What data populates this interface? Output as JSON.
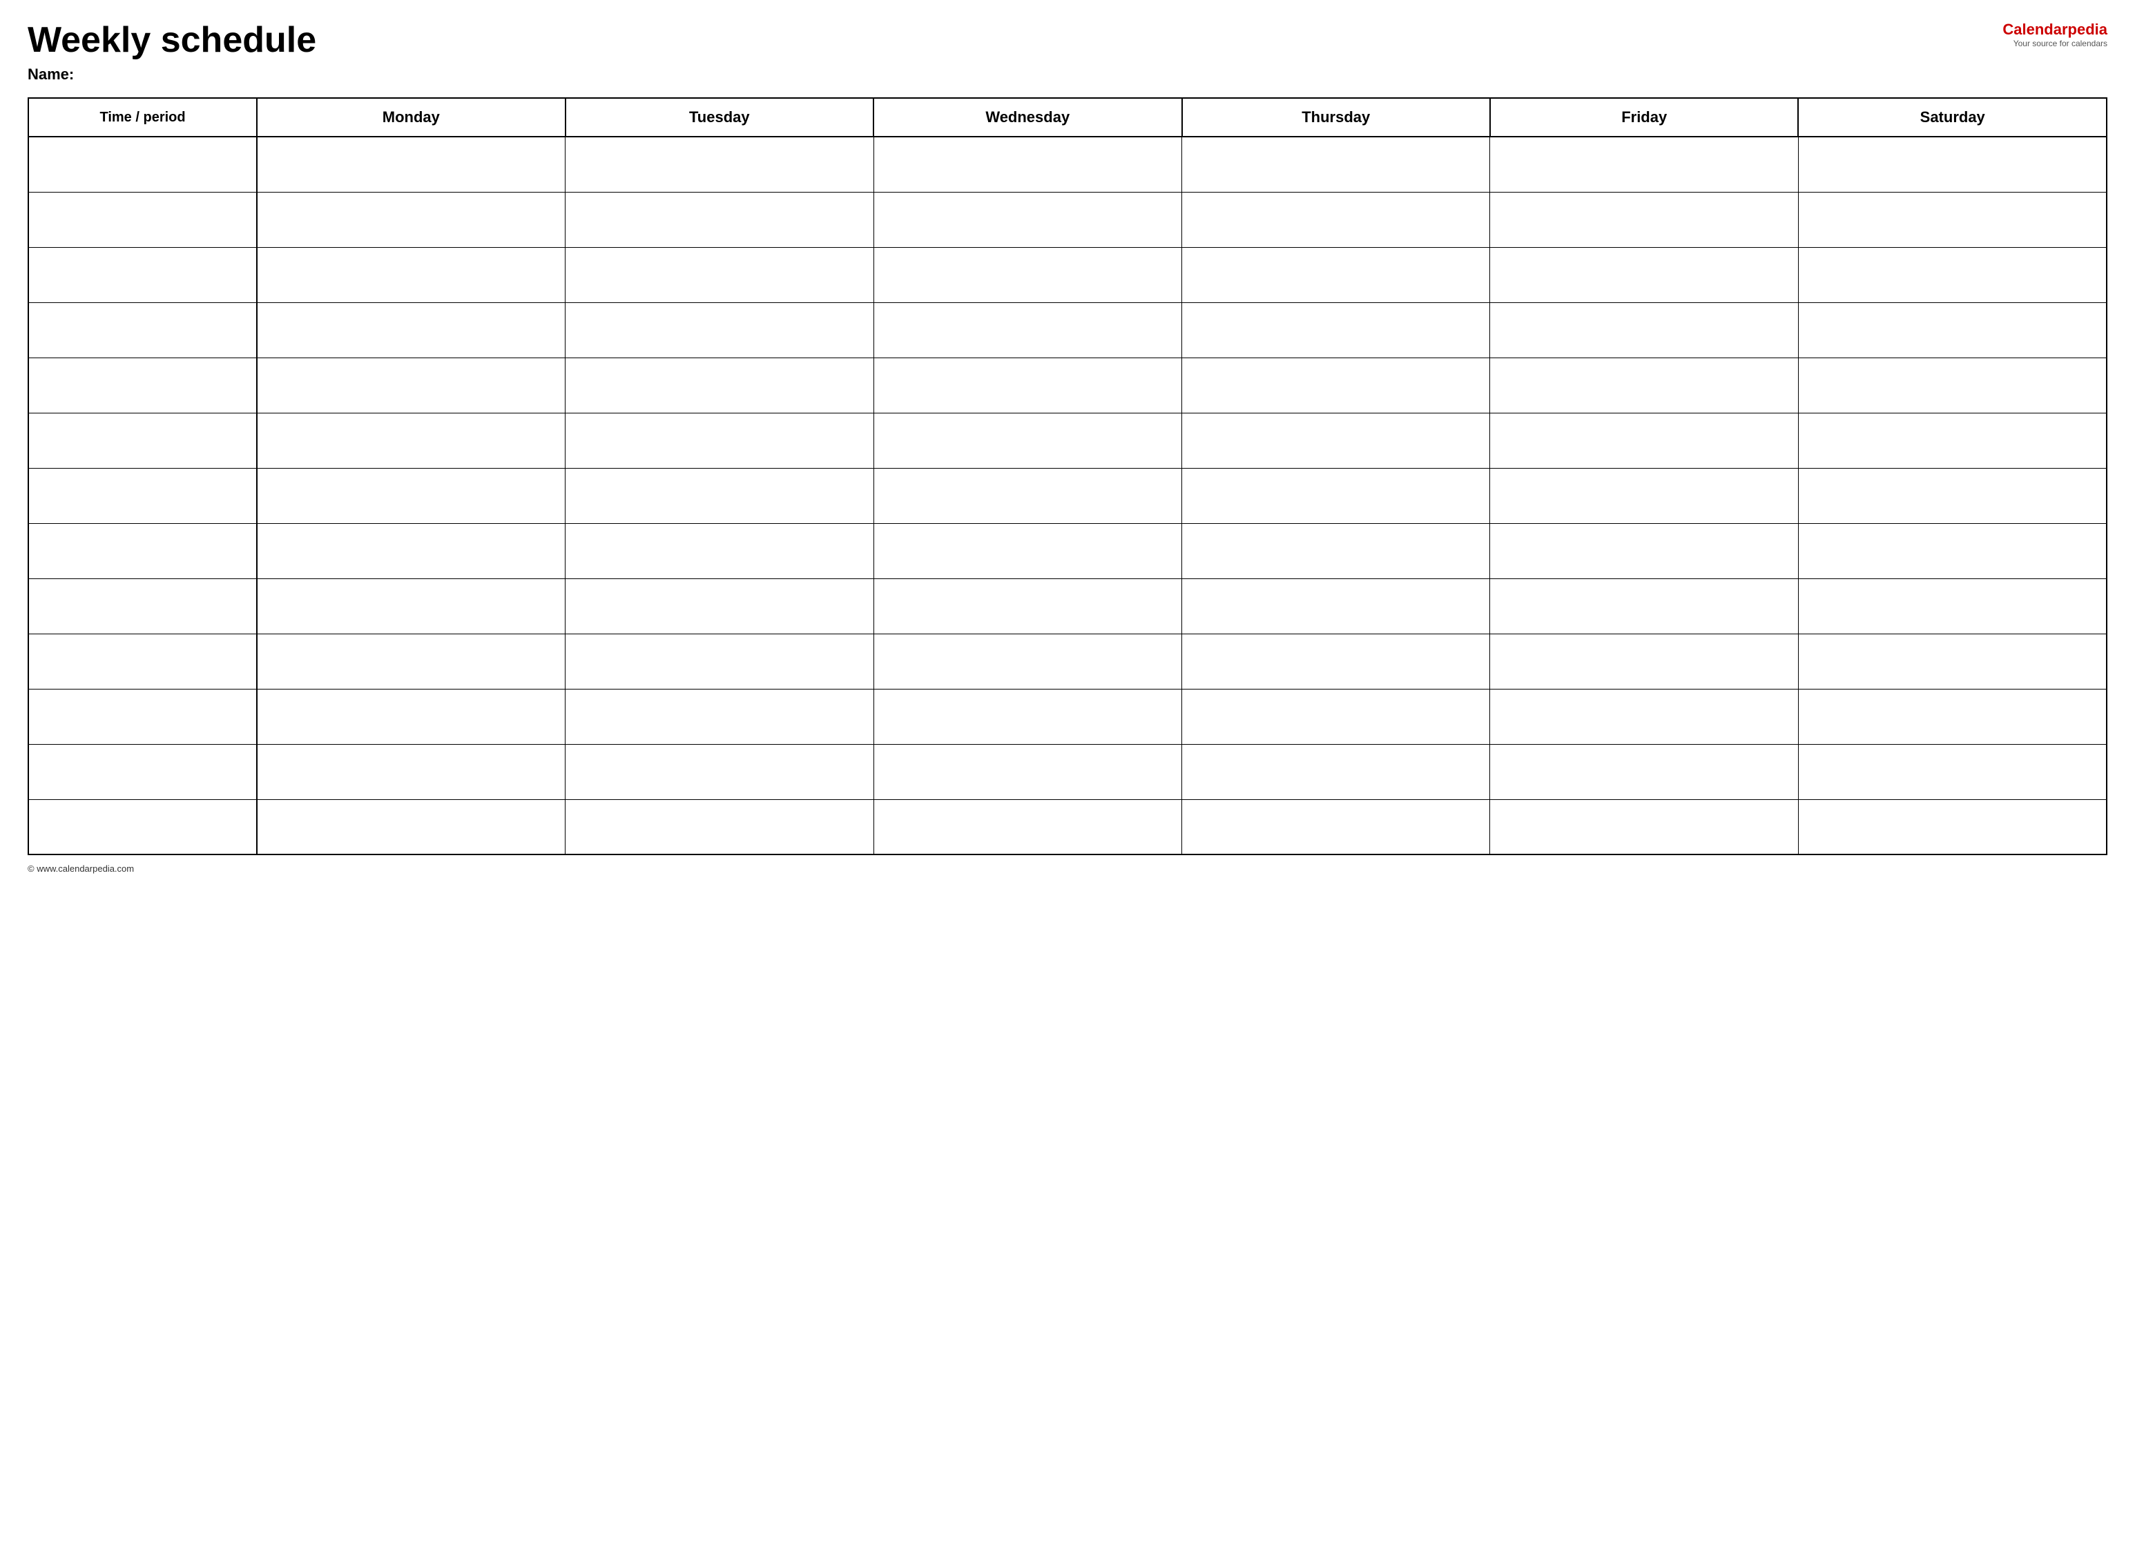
{
  "header": {
    "title": "Weekly schedule",
    "name_label": "Name:",
    "logo_main": "Calendar",
    "logo_accent": "pedia",
    "logo_sub": "Your source for calendars"
  },
  "table": {
    "columns": [
      {
        "key": "time",
        "label": "Time / period"
      },
      {
        "key": "monday",
        "label": "Monday"
      },
      {
        "key": "tuesday",
        "label": "Tuesday"
      },
      {
        "key": "wednesday",
        "label": "Wednesday"
      },
      {
        "key": "thursday",
        "label": "Thursday"
      },
      {
        "key": "friday",
        "label": "Friday"
      },
      {
        "key": "saturday",
        "label": "Saturday"
      }
    ],
    "row_count": 13
  },
  "footer": {
    "text": "© www.calendarpedia.com"
  }
}
